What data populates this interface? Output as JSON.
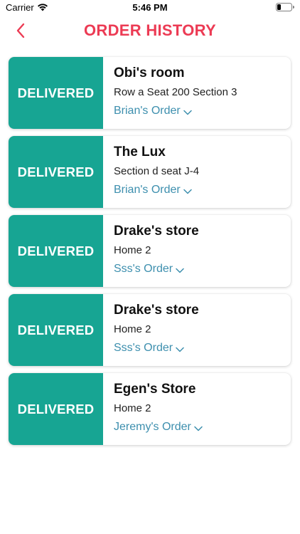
{
  "status_bar": {
    "carrier": "Carrier",
    "time": "5:46 PM"
  },
  "header": {
    "title": "ORDER HISTORY"
  },
  "colors": {
    "accent": "#ec3b54",
    "delivered": "#17a593",
    "link": "#3d8fae"
  },
  "orders": [
    {
      "status": "DELIVERED",
      "store": "Obi's room",
      "location": "Row a Seat 200 Section 3",
      "owner": "Brian's Order"
    },
    {
      "status": "DELIVERED",
      "store": "The Lux",
      "location": "Section d seat J-4",
      "owner": "Brian's Order"
    },
    {
      "status": "DELIVERED",
      "store": "Drake's store",
      "location": "Home 2",
      "owner": "Sss's Order"
    },
    {
      "status": "DELIVERED",
      "store": "Drake's store",
      "location": "Home 2",
      "owner": "Sss's Order"
    },
    {
      "status": "DELIVERED",
      "store": "Egen's Store",
      "location": "Home 2",
      "owner": "Jeremy's Order"
    }
  ]
}
